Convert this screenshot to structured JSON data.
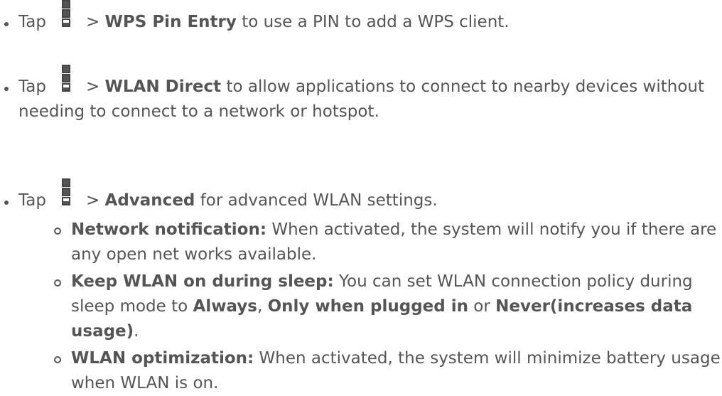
{
  "bullets": [
    {
      "prefix": "Tap",
      "icon": "overflow-menu-icon",
      "arrow": ">",
      "bold": "WPS Pin Entry",
      "rest": "to use a PIN to add a WPS client."
    },
    {
      "prefix": "Tap",
      "icon": "overflow-menu-icon",
      "arrow": ">",
      "bold": "WLAN Direct",
      "rest": "to allow applications to connect to nearby devices without needing to connect to a network or hotspot."
    },
    {
      "prefix": "Tap",
      "icon": "overflow-menu-icon",
      "arrow": ">",
      "bold": "Advanced",
      "rest": "for advanced WLAN settings."
    }
  ],
  "subbullets": [
    {
      "bold": "Network notification:",
      "rest": "When activated, the system will notify you if there are any open net works available."
    },
    {
      "bold": "Keep WLAN on during sleep:",
      "rest": "You can set WLAN connection policy during sleep mode to",
      "opt1": "Always",
      "sep1": ",",
      "opt2": "Only when plugged in",
      "sep2": "or",
      "opt3": "Never(increases data usage)",
      "end": "."
    },
    {
      "bold": "WLAN optimization:",
      "rest": "When activated, the system will minimize battery usage when WLAN is on."
    }
  ]
}
